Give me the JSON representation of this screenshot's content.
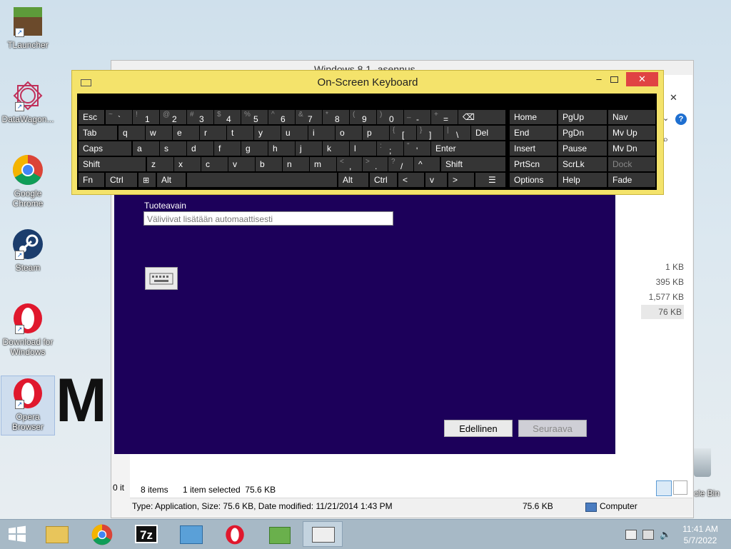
{
  "desktop": {
    "icons": [
      {
        "label": "TLauncher"
      },
      {
        "label": "DataWagon..."
      },
      {
        "label": "Google Chrome"
      },
      {
        "label": "Steam"
      },
      {
        "label": "Download for Windows"
      },
      {
        "label": "Opera Browser"
      }
    ],
    "recycle_bin_label": "cle Bin"
  },
  "explorer": {
    "title": "Windows 8.1 -asennus",
    "sizes": [
      "1 KB",
      "395 KB",
      "1,577 KB",
      "76 KB"
    ],
    "items_count": "8 items",
    "selected_info": "1 item selected  75.6 KB",
    "left_status": "0 it",
    "type_info": "Type: Application, Size: 75.6 KB, Date modified: 11/21/2014 1:43 PM",
    "size_info": "75.6 KB",
    "computer_label": "Computer"
  },
  "setup": {
    "product_key_label": "Tuoteavain",
    "product_key_placeholder": "Väliviivat lisätään automaattisesti",
    "back_button": "Edellinen",
    "next_button": "Seuraava"
  },
  "osk": {
    "title": "On-Screen Keyboard",
    "row1": [
      {
        "s": "~",
        "m": "`"
      },
      {
        "s": "!",
        "m": "1"
      },
      {
        "s": "@",
        "m": "2"
      },
      {
        "s": "#",
        "m": "3"
      },
      {
        "s": "$",
        "m": "4"
      },
      {
        "s": "%",
        "m": "5"
      },
      {
        "s": "^",
        "m": "6"
      },
      {
        "s": "&",
        "m": "7"
      },
      {
        "s": "*",
        "m": "8"
      },
      {
        "s": "(",
        "m": "9"
      },
      {
        "s": ")",
        "m": "0"
      },
      {
        "s": "_",
        "m": "-"
      },
      {
        "s": "+",
        "m": "="
      }
    ],
    "row2": [
      "q",
      "w",
      "e",
      "r",
      "t",
      "y",
      "u",
      "i",
      "o",
      "p"
    ],
    "row2_brackets": [
      {
        "s": "{",
        "m": "["
      },
      {
        "s": "}",
        "m": "]"
      },
      {
        "s": "|",
        "m": "\\"
      }
    ],
    "row3": [
      "a",
      "s",
      "d",
      "f",
      "g",
      "h",
      "j",
      "k",
      "l"
    ],
    "row3_punct": [
      {
        "s": ":",
        "m": ";"
      },
      {
        "s": "\"",
        "m": "'"
      }
    ],
    "row4": [
      "z",
      "x",
      "c",
      "v",
      "b",
      "n",
      "m"
    ],
    "row4_punct": [
      {
        "s": "<",
        "m": ","
      },
      {
        "s": ">",
        "m": "."
      },
      {
        "s": "?",
        "m": "/"
      }
    ],
    "labels": {
      "esc": "Esc",
      "tab": "Tab",
      "caps": "Caps",
      "shift": "Shift",
      "fn": "Fn",
      "ctrl": "Ctrl",
      "alt": "Alt",
      "del": "Del",
      "enter": "Enter",
      "lt": "<",
      "gt": ">",
      "up": "^",
      "down": "v"
    },
    "nav": {
      "home": "Home",
      "pgup": "PgUp",
      "navk": "Nav",
      "end": "End",
      "pgdn": "PgDn",
      "mvup": "Mv Up",
      "insert": "Insert",
      "pause": "Pause",
      "mvdn": "Mv Dn",
      "prtscn": "PrtScn",
      "scrlk": "ScrLk",
      "dock": "Dock",
      "options": "Options",
      "help": "Help",
      "fade": "Fade"
    }
  },
  "taskbar": {
    "time": "11:41 AM",
    "date": "5/7/2022",
    "sevenzip_label": "7z"
  },
  "colors": {
    "setup_bg": "#1c005a",
    "osk_frame": "#f4e36b",
    "close_red": "#e04343"
  }
}
